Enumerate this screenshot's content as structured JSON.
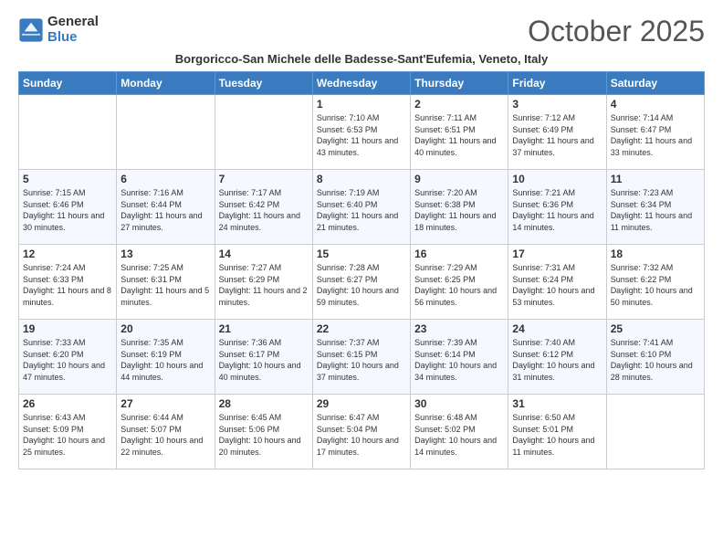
{
  "logo": {
    "general": "General",
    "blue": "Blue"
  },
  "title": "October 2025",
  "subtitle": "Borgoricco-San Michele delle Badesse-Sant'Eufemia, Veneto, Italy",
  "days_of_week": [
    "Sunday",
    "Monday",
    "Tuesday",
    "Wednesday",
    "Thursday",
    "Friday",
    "Saturday"
  ],
  "weeks": [
    [
      {
        "day": "",
        "info": ""
      },
      {
        "day": "",
        "info": ""
      },
      {
        "day": "",
        "info": ""
      },
      {
        "day": "1",
        "info": "Sunrise: 7:10 AM\nSunset: 6:53 PM\nDaylight: 11 hours and 43 minutes."
      },
      {
        "day": "2",
        "info": "Sunrise: 7:11 AM\nSunset: 6:51 PM\nDaylight: 11 hours and 40 minutes."
      },
      {
        "day": "3",
        "info": "Sunrise: 7:12 AM\nSunset: 6:49 PM\nDaylight: 11 hours and 37 minutes."
      },
      {
        "day": "4",
        "info": "Sunrise: 7:14 AM\nSunset: 6:47 PM\nDaylight: 11 hours and 33 minutes."
      }
    ],
    [
      {
        "day": "5",
        "info": "Sunrise: 7:15 AM\nSunset: 6:46 PM\nDaylight: 11 hours and 30 minutes."
      },
      {
        "day": "6",
        "info": "Sunrise: 7:16 AM\nSunset: 6:44 PM\nDaylight: 11 hours and 27 minutes."
      },
      {
        "day": "7",
        "info": "Sunrise: 7:17 AM\nSunset: 6:42 PM\nDaylight: 11 hours and 24 minutes."
      },
      {
        "day": "8",
        "info": "Sunrise: 7:19 AM\nSunset: 6:40 PM\nDaylight: 11 hours and 21 minutes."
      },
      {
        "day": "9",
        "info": "Sunrise: 7:20 AM\nSunset: 6:38 PM\nDaylight: 11 hours and 18 minutes."
      },
      {
        "day": "10",
        "info": "Sunrise: 7:21 AM\nSunset: 6:36 PM\nDaylight: 11 hours and 14 minutes."
      },
      {
        "day": "11",
        "info": "Sunrise: 7:23 AM\nSunset: 6:34 PM\nDaylight: 11 hours and 11 minutes."
      }
    ],
    [
      {
        "day": "12",
        "info": "Sunrise: 7:24 AM\nSunset: 6:33 PM\nDaylight: 11 hours and 8 minutes."
      },
      {
        "day": "13",
        "info": "Sunrise: 7:25 AM\nSunset: 6:31 PM\nDaylight: 11 hours and 5 minutes."
      },
      {
        "day": "14",
        "info": "Sunrise: 7:27 AM\nSunset: 6:29 PM\nDaylight: 11 hours and 2 minutes."
      },
      {
        "day": "15",
        "info": "Sunrise: 7:28 AM\nSunset: 6:27 PM\nDaylight: 10 hours and 59 minutes."
      },
      {
        "day": "16",
        "info": "Sunrise: 7:29 AM\nSunset: 6:25 PM\nDaylight: 10 hours and 56 minutes."
      },
      {
        "day": "17",
        "info": "Sunrise: 7:31 AM\nSunset: 6:24 PM\nDaylight: 10 hours and 53 minutes."
      },
      {
        "day": "18",
        "info": "Sunrise: 7:32 AM\nSunset: 6:22 PM\nDaylight: 10 hours and 50 minutes."
      }
    ],
    [
      {
        "day": "19",
        "info": "Sunrise: 7:33 AM\nSunset: 6:20 PM\nDaylight: 10 hours and 47 minutes."
      },
      {
        "day": "20",
        "info": "Sunrise: 7:35 AM\nSunset: 6:19 PM\nDaylight: 10 hours and 44 minutes."
      },
      {
        "day": "21",
        "info": "Sunrise: 7:36 AM\nSunset: 6:17 PM\nDaylight: 10 hours and 40 minutes."
      },
      {
        "day": "22",
        "info": "Sunrise: 7:37 AM\nSunset: 6:15 PM\nDaylight: 10 hours and 37 minutes."
      },
      {
        "day": "23",
        "info": "Sunrise: 7:39 AM\nSunset: 6:14 PM\nDaylight: 10 hours and 34 minutes."
      },
      {
        "day": "24",
        "info": "Sunrise: 7:40 AM\nSunset: 6:12 PM\nDaylight: 10 hours and 31 minutes."
      },
      {
        "day": "25",
        "info": "Sunrise: 7:41 AM\nSunset: 6:10 PM\nDaylight: 10 hours and 28 minutes."
      }
    ],
    [
      {
        "day": "26",
        "info": "Sunrise: 6:43 AM\nSunset: 5:09 PM\nDaylight: 10 hours and 25 minutes."
      },
      {
        "day": "27",
        "info": "Sunrise: 6:44 AM\nSunset: 5:07 PM\nDaylight: 10 hours and 22 minutes."
      },
      {
        "day": "28",
        "info": "Sunrise: 6:45 AM\nSunset: 5:06 PM\nDaylight: 10 hours and 20 minutes."
      },
      {
        "day": "29",
        "info": "Sunrise: 6:47 AM\nSunset: 5:04 PM\nDaylight: 10 hours and 17 minutes."
      },
      {
        "day": "30",
        "info": "Sunrise: 6:48 AM\nSunset: 5:02 PM\nDaylight: 10 hours and 14 minutes."
      },
      {
        "day": "31",
        "info": "Sunrise: 6:50 AM\nSunset: 5:01 PM\nDaylight: 10 hours and 11 minutes."
      },
      {
        "day": "",
        "info": ""
      }
    ]
  ]
}
